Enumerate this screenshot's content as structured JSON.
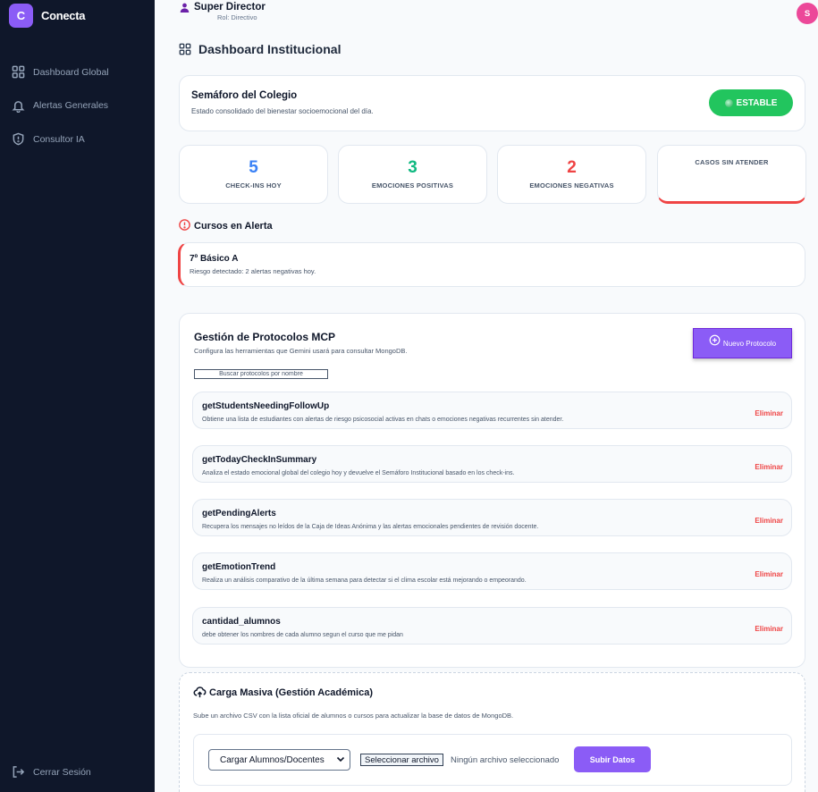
{
  "app": {
    "badge_letter": "C",
    "name": "Conecta"
  },
  "sidebar": {
    "items": [
      {
        "label": "Dashboard Global",
        "icon": "grid-icon"
      },
      {
        "label": "Alertas Generales",
        "icon": "bell-icon"
      },
      {
        "label": "Consultor IA",
        "icon": "shield-icon"
      }
    ],
    "logout": "Cerrar Sesión"
  },
  "header": {
    "user_name": "Super Director",
    "user_role": "Rol: Directivo",
    "avatar_letter": "S"
  },
  "page": {
    "title": "Dashboard Institucional"
  },
  "semaforo": {
    "title": "Semáforo del Colegio",
    "description": "Estado consolidado del bienestar socioemocional del día.",
    "status": "ESTABLE",
    "status_color": "#22c55e"
  },
  "stats": [
    {
      "value": "5",
      "label": "CHECK-INS HOY",
      "color": "#3b82f6"
    },
    {
      "value": "3",
      "label": "EMOCIONES POSITIVAS",
      "color": "#10b981"
    },
    {
      "value": "2",
      "label": "EMOCIONES NEGATIVAS",
      "color": "#ef4444"
    },
    {
      "value": "",
      "label": "CASOS SIN ATENDER",
      "color": "#ef4444"
    }
  ],
  "cursos": {
    "title": "Cursos en Alerta",
    "items": [
      {
        "name": "7º Básico A",
        "description": "Riesgo detectado: 2 alertas negativas hoy."
      }
    ]
  },
  "mcp": {
    "title": "Gestión de Protocolos MCP",
    "description": "Configura las herramientas que Gemini usará para consultar MongoDB.",
    "new_button": "Nuevo Protocolo",
    "search_placeholder": "Buscar protocolos por nombre",
    "delete_label": "Eliminar",
    "protocols": [
      {
        "name": "getStudentsNeedingFollowUp",
        "description": "Obtiene una lista de estudiantes con alertas de riesgo psicosocial activas en chats o emociones negativas recurrentes sin atender."
      },
      {
        "name": "getTodayCheckInSummary",
        "description": "Analiza el estado emocional global del colegio hoy y devuelve el Semáforo Institucional basado en los check-ins."
      },
      {
        "name": "getPendingAlerts",
        "description": "Recupera los mensajes no leídos de la Caja de Ideas Anónima y las alertas emocionales pendientes de revisión docente."
      },
      {
        "name": "getEmotionTrend",
        "description": "Realiza un análisis comparativo de la última semana para detectar si el clima escolar está mejorando o empeorando."
      },
      {
        "name": "cantidad_alumnos",
        "description": "debe obtener los nombres de cada alumno segun el curso que me pidan"
      }
    ]
  },
  "carga": {
    "title": "Carga Masiva (Gestión Académica)",
    "description": "Sube un archivo CSV con la lista oficial de alumnos o cursos para actualizar la base de datos de MongoDB.",
    "select_value": "Cargar Alumnos/Docentes",
    "file_button": "Seleccionar archivo",
    "file_status": "Ningún archivo seleccionado",
    "submit": "Subir Datos"
  }
}
